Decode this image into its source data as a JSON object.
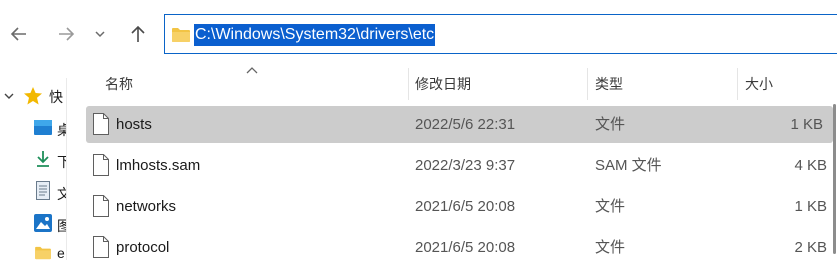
{
  "address_bar": {
    "path": "C:\\Windows\\System32\\drivers\\etc"
  },
  "nav": {
    "back": "back-arrow",
    "forward": "forward-arrow",
    "recent": "chevron-down",
    "up": "up-arrow"
  },
  "sidebar": {
    "items": [
      {
        "label": "快",
        "icon": "star-icon",
        "expand": "chevron-down"
      },
      {
        "label": "桌",
        "icon": "desktop-icon"
      },
      {
        "label": "下",
        "icon": "download-icon"
      },
      {
        "label": "文",
        "icon": "document-icon"
      },
      {
        "label": "图",
        "icon": "pictures-icon"
      },
      {
        "label": "e",
        "icon": "folder-icon"
      }
    ]
  },
  "columns": {
    "name": "名称",
    "date": "修改日期",
    "type": "类型",
    "size": "大小"
  },
  "files": [
    {
      "name": "hosts",
      "date": "2022/5/6 22:31",
      "type": "文件",
      "size": "1 KB",
      "selected": true
    },
    {
      "name": "lmhosts.sam",
      "date": "2022/3/23 9:37",
      "type": "SAM 文件",
      "size": "4 KB",
      "selected": false
    },
    {
      "name": "networks",
      "date": "2021/6/5 20:08",
      "type": "文件",
      "size": "1 KB",
      "selected": false
    },
    {
      "name": "protocol",
      "date": "2021/6/5 20:08",
      "type": "文件",
      "size": "2 KB",
      "selected": false
    }
  ],
  "colors": {
    "selection": "#0b5fcf",
    "accent": "#0a64c8",
    "row_selected": "#cccccc",
    "folder": "#f2c445"
  }
}
